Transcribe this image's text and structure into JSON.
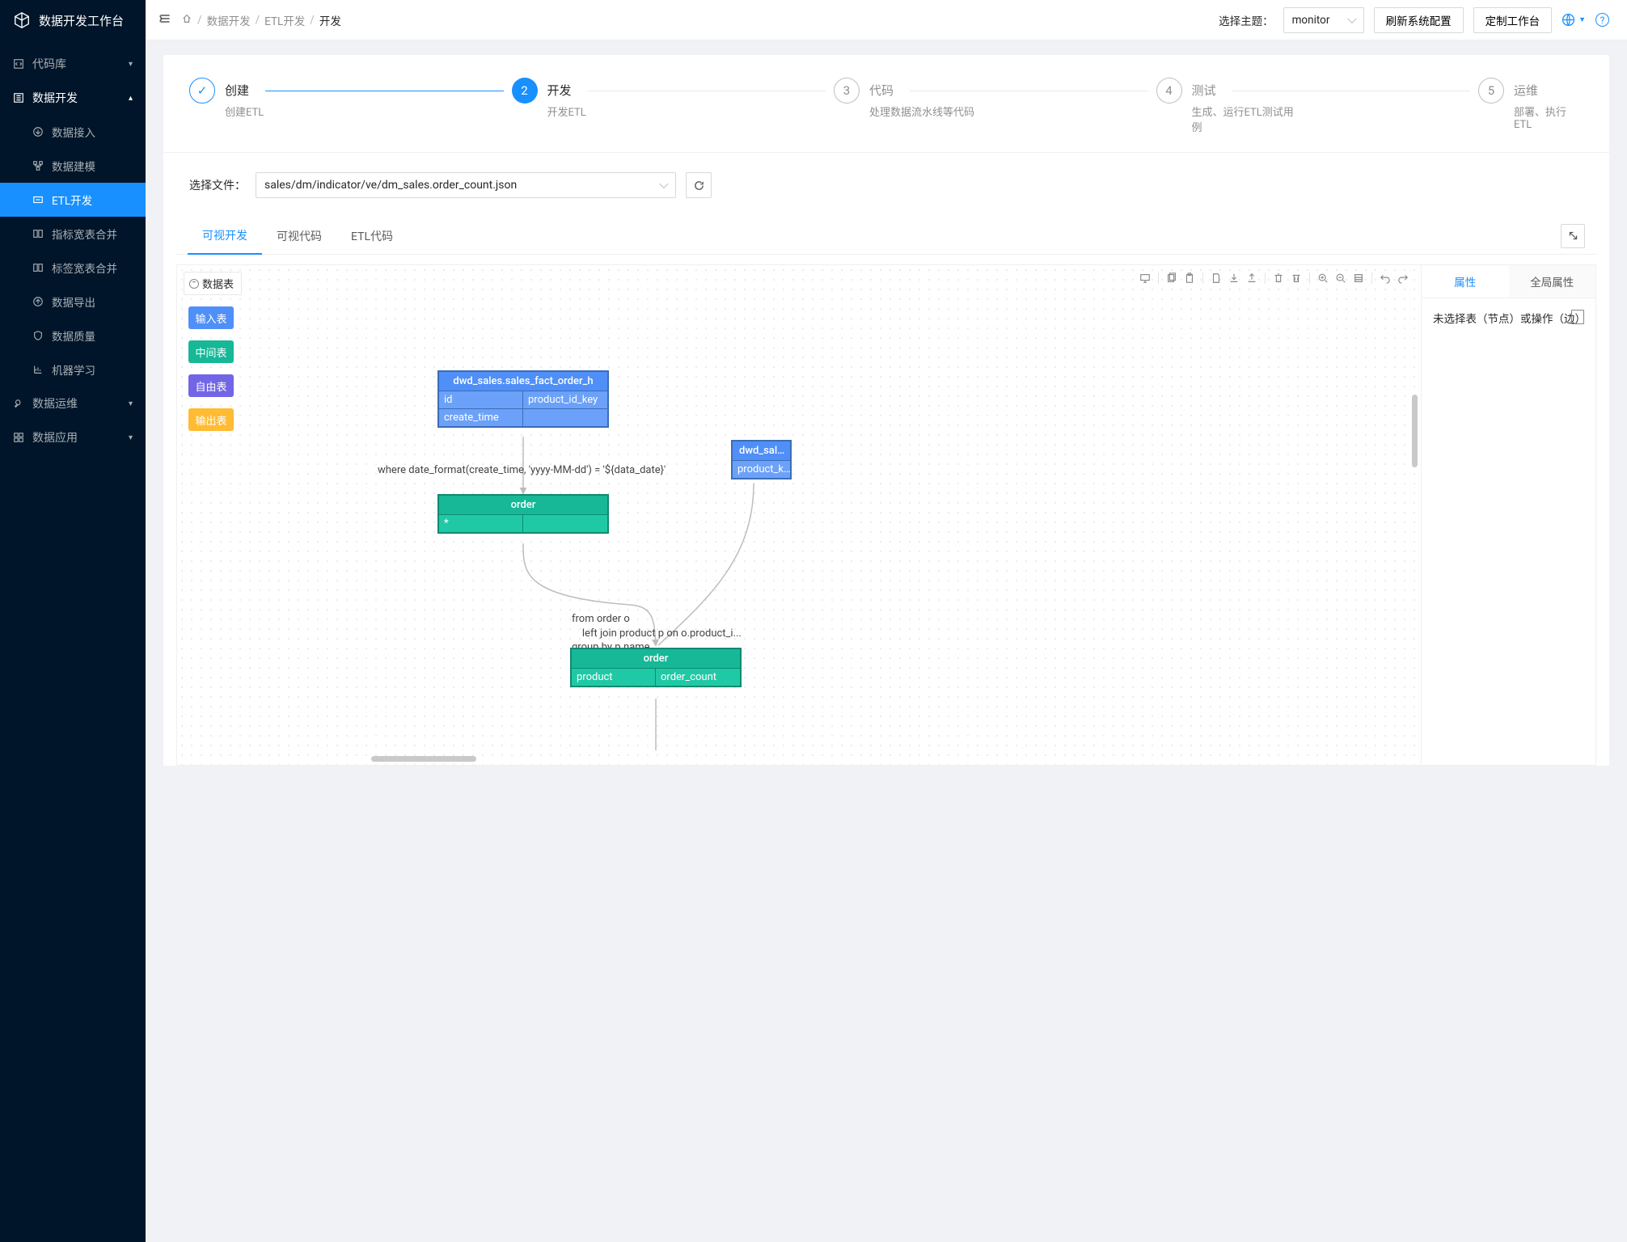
{
  "app": {
    "title": "数据开发工作台"
  },
  "sidebar": {
    "items": [
      {
        "icon": "code",
        "label": "代码库",
        "kind": "group"
      },
      {
        "icon": "data",
        "label": "数据开发",
        "kind": "group-open",
        "children": [
          {
            "icon": "import",
            "label": "数据接入"
          },
          {
            "icon": "model",
            "label": "数据建模"
          },
          {
            "icon": "etl",
            "label": "ETL开发",
            "active": true
          },
          {
            "icon": "merge",
            "label": "指标宽表合并"
          },
          {
            "icon": "merge",
            "label": "标签宽表合并"
          },
          {
            "icon": "export",
            "label": "数据导出"
          },
          {
            "icon": "quality",
            "label": "数据质量"
          },
          {
            "icon": "ml",
            "label": "机器学习"
          }
        ]
      },
      {
        "icon": "ops",
        "label": "数据运维",
        "kind": "group"
      },
      {
        "icon": "apps",
        "label": "数据应用",
        "kind": "group"
      }
    ]
  },
  "topbar": {
    "breadcrumb": [
      "数据开发",
      "ETL开发",
      "开发"
    ],
    "theme_label": "选择主题：",
    "theme_value": "monitor",
    "refresh_btn": "刷新系统配置",
    "customize_btn": "定制工作台"
  },
  "steps": [
    {
      "title": "创建",
      "desc": "创建ETL",
      "state": "done"
    },
    {
      "title": "开发",
      "desc": "开发ETL",
      "state": "active",
      "num": "2"
    },
    {
      "title": "代码",
      "desc": "处理数据流水线等代码",
      "state": "wait",
      "num": "3"
    },
    {
      "title": "测试",
      "desc": "生成、运行ETL测试用例",
      "state": "wait",
      "num": "4"
    },
    {
      "title": "运维",
      "desc": "部署、执行ETL",
      "state": "wait",
      "num": "5"
    }
  ],
  "file": {
    "label": "选择文件：",
    "value": "sales/dm/indicator/ve/dm_sales.order_count.json"
  },
  "tabs": {
    "t1": "可视开发",
    "t2": "可视代码",
    "t3": "ETL代码"
  },
  "palette": {
    "head": "数据表",
    "input": "输入表",
    "mid": "中间表",
    "free": "自由表",
    "out": "输出表"
  },
  "nodes": {
    "n1": {
      "title": "dwd_sales.sales_fact_order_h",
      "c11": "id",
      "c12": "product_id_key",
      "c21": "create_time",
      "c22": ""
    },
    "n2": {
      "title": "dwd_sal…",
      "c11": "product_k…"
    },
    "n3": {
      "title": "order",
      "c11": "*",
      "c12": ""
    },
    "n4": {
      "title": "order",
      "c11": "product",
      "c12": "order_count"
    }
  },
  "edge_labels": {
    "e1": "where date_format(create_time, 'yyyy-MM-dd') = '${data_date}'",
    "e2a": "from order o",
    "e2b": "    left join product p on o.product_i...",
    "e2c": "group by p.name"
  },
  "right": {
    "tab1": "属性",
    "tab2": "全局属性",
    "empty": "未选择表（节点）或操作（边）"
  }
}
